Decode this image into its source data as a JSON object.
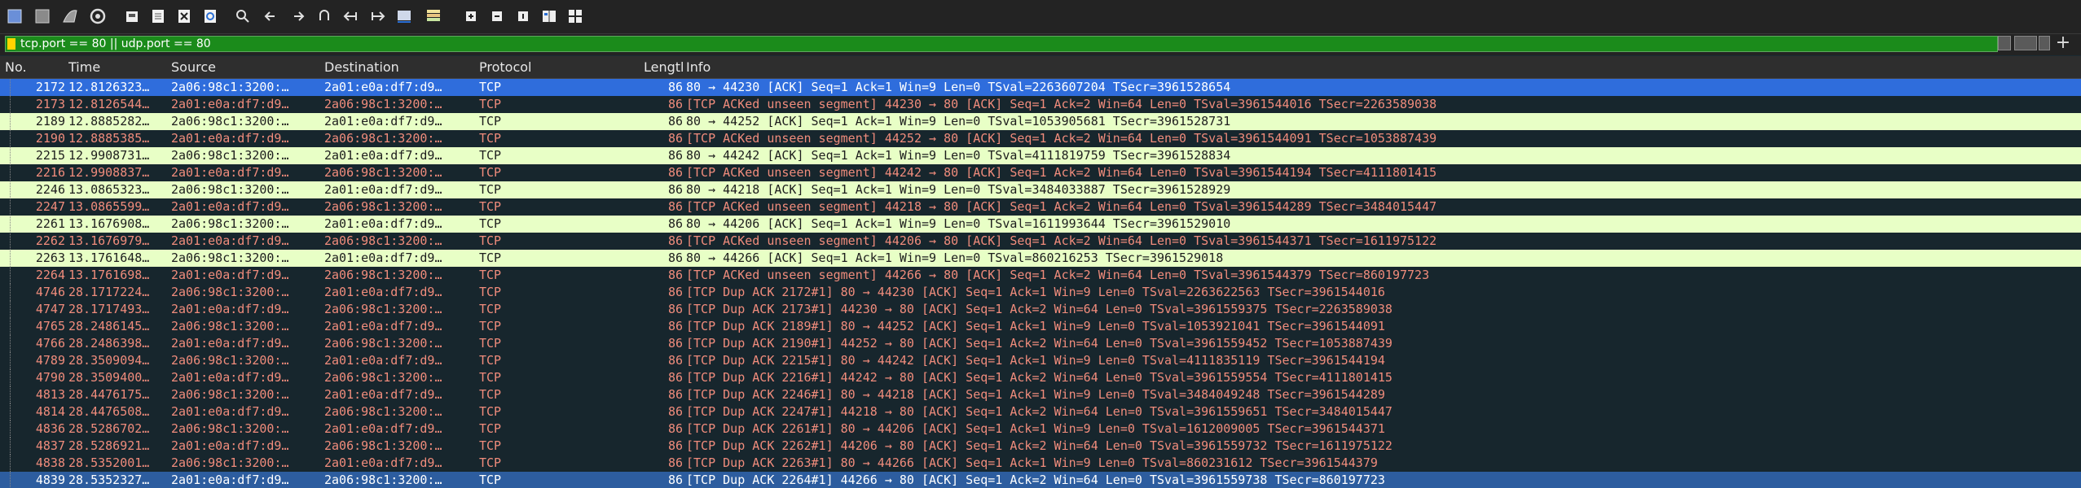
{
  "filter": {
    "value": "tcp.port == 80 || udp.port == 80"
  },
  "toolbar": {
    "icons": [
      "shark-fin-start-icon",
      "stop-icon",
      "shark-fin-restart-icon",
      "options-gear-icon",
      "open-folder-icon",
      "save-file-icon",
      "close-file-icon",
      "reload-icon",
      "search-icon",
      "back-arrow-icon",
      "forward-arrow-icon",
      "go-to-packet-icon",
      "first-packet-icon",
      "last-packet-icon",
      "autoscroll-icon",
      "colorize-icon",
      "zoom-in-icon",
      "zoom-out-icon",
      "normal-size-icon",
      "resize-columns-icon",
      "preferences-grid-icon"
    ]
  },
  "columns": {
    "no": "No.",
    "time": "Time",
    "source": "Source",
    "destination": "Destination",
    "protocol": "Protocol",
    "length": "Lengtl",
    "info": "Info"
  },
  "rows": [
    {
      "no": "2172",
      "time": "12.8126323…",
      "src": "2a06:98c1:3200:…",
      "dst": "2a01:e0a:df7:d9…",
      "proto": "TCP",
      "len": "86",
      "info": "80 → 44230 [ACK] Seq=1 Ack=1 Win=9 Len=0 TSval=2263607204 TSecr=3961528654",
      "type": "sel"
    },
    {
      "no": "2173",
      "time": "12.8126544…",
      "src": "2a01:e0a:df7:d9…",
      "dst": "2a06:98c1:3200:…",
      "proto": "TCP",
      "len": "86",
      "info": "[TCP ACKed unseen segment] 44230 → 80 [ACK] Seq=1 Ack=2 Win=64 Len=0 TSval=3961544016 TSecr=2263589038",
      "type": "err"
    },
    {
      "no": "2189",
      "time": "12.8885282…",
      "src": "2a06:98c1:3200:…",
      "dst": "2a01:e0a:df7:d9…",
      "proto": "TCP",
      "len": "86",
      "info": "80 → 44252 [ACK] Seq=1 Ack=1 Win=9 Len=0 TSval=1053905681 TSecr=3961528731",
      "type": "ack"
    },
    {
      "no": "2190",
      "time": "12.8885385…",
      "src": "2a01:e0a:df7:d9…",
      "dst": "2a06:98c1:3200:…",
      "proto": "TCP",
      "len": "86",
      "info": "[TCP ACKed unseen segment] 44252 → 80 [ACK] Seq=1 Ack=2 Win=64 Len=0 TSval=3961544091 TSecr=1053887439",
      "type": "err"
    },
    {
      "no": "2215",
      "time": "12.9908731…",
      "src": "2a06:98c1:3200:…",
      "dst": "2a01:e0a:df7:d9…",
      "proto": "TCP",
      "len": "86",
      "info": "80 → 44242 [ACK] Seq=1 Ack=1 Win=9 Len=0 TSval=4111819759 TSecr=3961528834",
      "type": "ack"
    },
    {
      "no": "2216",
      "time": "12.9908837…",
      "src": "2a01:e0a:df7:d9…",
      "dst": "2a06:98c1:3200:…",
      "proto": "TCP",
      "len": "86",
      "info": "[TCP ACKed unseen segment] 44242 → 80 [ACK] Seq=1 Ack=2 Win=64 Len=0 TSval=3961544194 TSecr=4111801415",
      "type": "err"
    },
    {
      "no": "2246",
      "time": "13.0865323…",
      "src": "2a06:98c1:3200:…",
      "dst": "2a01:e0a:df7:d9…",
      "proto": "TCP",
      "len": "86",
      "info": "80 → 44218 [ACK] Seq=1 Ack=1 Win=9 Len=0 TSval=3484033887 TSecr=3961528929",
      "type": "ack"
    },
    {
      "no": "2247",
      "time": "13.0865599…",
      "src": "2a01:e0a:df7:d9…",
      "dst": "2a06:98c1:3200:…",
      "proto": "TCP",
      "len": "86",
      "info": "[TCP ACKed unseen segment] 44218 → 80 [ACK] Seq=1 Ack=2 Win=64 Len=0 TSval=3961544289 TSecr=3484015447",
      "type": "err"
    },
    {
      "no": "2261",
      "time": "13.1676908…",
      "src": "2a06:98c1:3200:…",
      "dst": "2a01:e0a:df7:d9…",
      "proto": "TCP",
      "len": "86",
      "info": "80 → 44206 [ACK] Seq=1 Ack=1 Win=9 Len=0 TSval=1611993644 TSecr=3961529010",
      "type": "ack"
    },
    {
      "no": "2262",
      "time": "13.1676979…",
      "src": "2a01:e0a:df7:d9…",
      "dst": "2a06:98c1:3200:…",
      "proto": "TCP",
      "len": "86",
      "info": "[TCP ACKed unseen segment] 44206 → 80 [ACK] Seq=1 Ack=2 Win=64 Len=0 TSval=3961544371 TSecr=1611975122",
      "type": "err"
    },
    {
      "no": "2263",
      "time": "13.1761648…",
      "src": "2a06:98c1:3200:…",
      "dst": "2a01:e0a:df7:d9…",
      "proto": "TCP",
      "len": "86",
      "info": "80 → 44266 [ACK] Seq=1 Ack=1 Win=9 Len=0 TSval=860216253 TSecr=3961529018",
      "type": "ack"
    },
    {
      "no": "2264",
      "time": "13.1761698…",
      "src": "2a01:e0a:df7:d9…",
      "dst": "2a06:98c1:3200:…",
      "proto": "TCP",
      "len": "86",
      "info": "[TCP ACKed unseen segment] 44266 → 80 [ACK] Seq=1 Ack=2 Win=64 Len=0 TSval=3961544379 TSecr=860197723",
      "type": "err"
    },
    {
      "no": "4746",
      "time": "28.1717224…",
      "src": "2a06:98c1:3200:…",
      "dst": "2a01:e0a:df7:d9…",
      "proto": "TCP",
      "len": "86",
      "info": "[TCP Dup ACK 2172#1] 80 → 44230 [ACK] Seq=1 Ack=1 Win=9 Len=0 TSval=2263622563 TSecr=3961544016",
      "type": "dup"
    },
    {
      "no": "4747",
      "time": "28.1717493…",
      "src": "2a01:e0a:df7:d9…",
      "dst": "2a06:98c1:3200:…",
      "proto": "TCP",
      "len": "86",
      "info": "[TCP Dup ACK 2173#1] 44230 → 80 [ACK] Seq=1 Ack=2 Win=64 Len=0 TSval=3961559375 TSecr=2263589038",
      "type": "dup"
    },
    {
      "no": "4765",
      "time": "28.2486145…",
      "src": "2a06:98c1:3200:…",
      "dst": "2a01:e0a:df7:d9…",
      "proto": "TCP",
      "len": "86",
      "info": "[TCP Dup ACK 2189#1] 80 → 44252 [ACK] Seq=1 Ack=1 Win=9 Len=0 TSval=1053921041 TSecr=3961544091",
      "type": "dup"
    },
    {
      "no": "4766",
      "time": "28.2486398…",
      "src": "2a01:e0a:df7:d9…",
      "dst": "2a06:98c1:3200:…",
      "proto": "TCP",
      "len": "86",
      "info": "[TCP Dup ACK 2190#1] 44252 → 80 [ACK] Seq=1 Ack=2 Win=64 Len=0 TSval=3961559452 TSecr=1053887439",
      "type": "dup"
    },
    {
      "no": "4789",
      "time": "28.3509094…",
      "src": "2a06:98c1:3200:…",
      "dst": "2a01:e0a:df7:d9…",
      "proto": "TCP",
      "len": "86",
      "info": "[TCP Dup ACK 2215#1] 80 → 44242 [ACK] Seq=1 Ack=1 Win=9 Len=0 TSval=4111835119 TSecr=3961544194",
      "type": "dup"
    },
    {
      "no": "4790",
      "time": "28.3509400…",
      "src": "2a01:e0a:df7:d9…",
      "dst": "2a06:98c1:3200:…",
      "proto": "TCP",
      "len": "86",
      "info": "[TCP Dup ACK 2216#1] 44242 → 80 [ACK] Seq=1 Ack=2 Win=64 Len=0 TSval=3961559554 TSecr=4111801415",
      "type": "dup"
    },
    {
      "no": "4813",
      "time": "28.4476175…",
      "src": "2a06:98c1:3200:…",
      "dst": "2a01:e0a:df7:d9…",
      "proto": "TCP",
      "len": "86",
      "info": "[TCP Dup ACK 2246#1] 80 → 44218 [ACK] Seq=1 Ack=1 Win=9 Len=0 TSval=3484049248 TSecr=3961544289",
      "type": "dup"
    },
    {
      "no": "4814",
      "time": "28.4476508…",
      "src": "2a01:e0a:df7:d9…",
      "dst": "2a06:98c1:3200:…",
      "proto": "TCP",
      "len": "86",
      "info": "[TCP Dup ACK 2247#1] 44218 → 80 [ACK] Seq=1 Ack=2 Win=64 Len=0 TSval=3961559651 TSecr=3484015447",
      "type": "dup"
    },
    {
      "no": "4836",
      "time": "28.5286702…",
      "src": "2a06:98c1:3200:…",
      "dst": "2a01:e0a:df7:d9…",
      "proto": "TCP",
      "len": "86",
      "info": "[TCP Dup ACK 2261#1] 80 → 44206 [ACK] Seq=1 Ack=1 Win=9 Len=0 TSval=1612009005 TSecr=3961544371",
      "type": "dup"
    },
    {
      "no": "4837",
      "time": "28.5286921…",
      "src": "2a01:e0a:df7:d9…",
      "dst": "2a06:98c1:3200:…",
      "proto": "TCP",
      "len": "86",
      "info": "[TCP Dup ACK 2262#1] 44206 → 80 [ACK] Seq=1 Ack=2 Win=64 Len=0 TSval=3961559732 TSecr=1611975122",
      "type": "dup"
    },
    {
      "no": "4838",
      "time": "28.5352001…",
      "src": "2a06:98c1:3200:…",
      "dst": "2a01:e0a:df7:d9…",
      "proto": "TCP",
      "len": "86",
      "info": "[TCP Dup ACK 2263#1] 80 → 44266 [ACK] Seq=1 Ack=1 Win=9 Len=0 TSval=860231612 TSecr=3961544379",
      "type": "dup"
    },
    {
      "no": "4839",
      "time": "28.5352327…",
      "src": "2a01:e0a:df7:d9…",
      "dst": "2a06:98c1:3200:…",
      "proto": "TCP",
      "len": "86",
      "info": "[TCP Dup ACK 2264#1] 44266 → 80 [ACK] Seq=1 Ack=2 Win=64 Len=0 TSval=3961559738 TSecr=860197723",
      "type": "sel2"
    }
  ],
  "colors": {
    "selected": "#2f6ddc",
    "error_text": "#f08c7c",
    "ack_row": "#e8ffc6",
    "filter_ok": "#1b8b1b"
  }
}
